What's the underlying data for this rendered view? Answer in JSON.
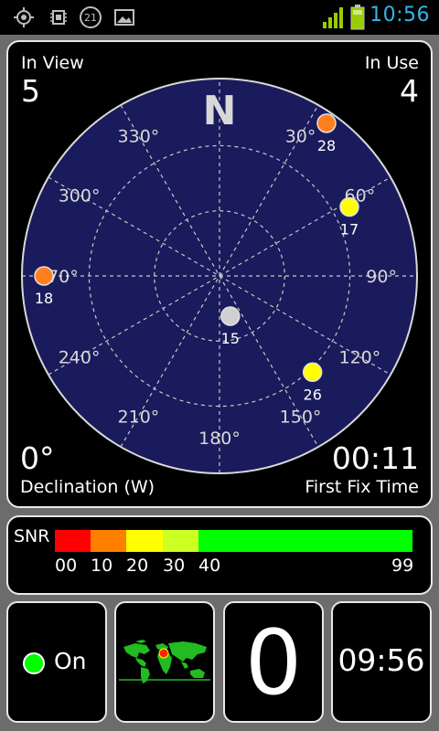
{
  "status_bar": {
    "icons": [
      "gps-icon",
      "sim-icon",
      "notification-21-icon",
      "image-icon"
    ],
    "notification_count": "21",
    "signal_icon": "signal-bars-icon",
    "battery_icon": "battery-icon",
    "time": "10:56",
    "accent_color": "#33b5e5"
  },
  "radar": {
    "in_view_label": "In View",
    "in_view_value": "5",
    "in_use_label": "In Use",
    "in_use_value": "4",
    "north_label": "N",
    "declination_value": "0°",
    "declination_label": "Declination (W)",
    "first_fix_value": "00:11",
    "first_fix_label": "First Fix Time",
    "bearings": [
      "30°",
      "60°",
      "90°",
      "120°",
      "150°",
      "180°",
      "210°",
      "240°",
      "270°",
      "300°",
      "330°"
    ],
    "satellites": [
      {
        "prn": "28",
        "azimuth": 35,
        "elevation": 5,
        "color": "#ff7f1e"
      },
      {
        "prn": "17",
        "azimuth": 62,
        "elevation": 23,
        "color": "#ffff00"
      },
      {
        "prn": "18",
        "azimuth": 270,
        "elevation": 10,
        "color": "#ff7f1e"
      },
      {
        "prn": "15",
        "azimuth": 165,
        "elevation": 71,
        "color": "#d0d0d0"
      },
      {
        "prn": "26",
        "azimuth": 136,
        "elevation": 29,
        "color": "#ffff00"
      }
    ]
  },
  "snr": {
    "label": "SNR",
    "ticks": [
      "00",
      "10",
      "20",
      "30",
      "40",
      "99"
    ],
    "segments": [
      {
        "color": "#ff0000"
      },
      {
        "color": "#ff8000"
      },
      {
        "color": "#ffff00"
      },
      {
        "color": "#ccff22"
      },
      {
        "color": "#00ff00"
      }
    ]
  },
  "tiles": {
    "gps_state": "On",
    "map_icon": "world-map-icon",
    "count_value": "0",
    "clock_value": "09:56"
  }
}
